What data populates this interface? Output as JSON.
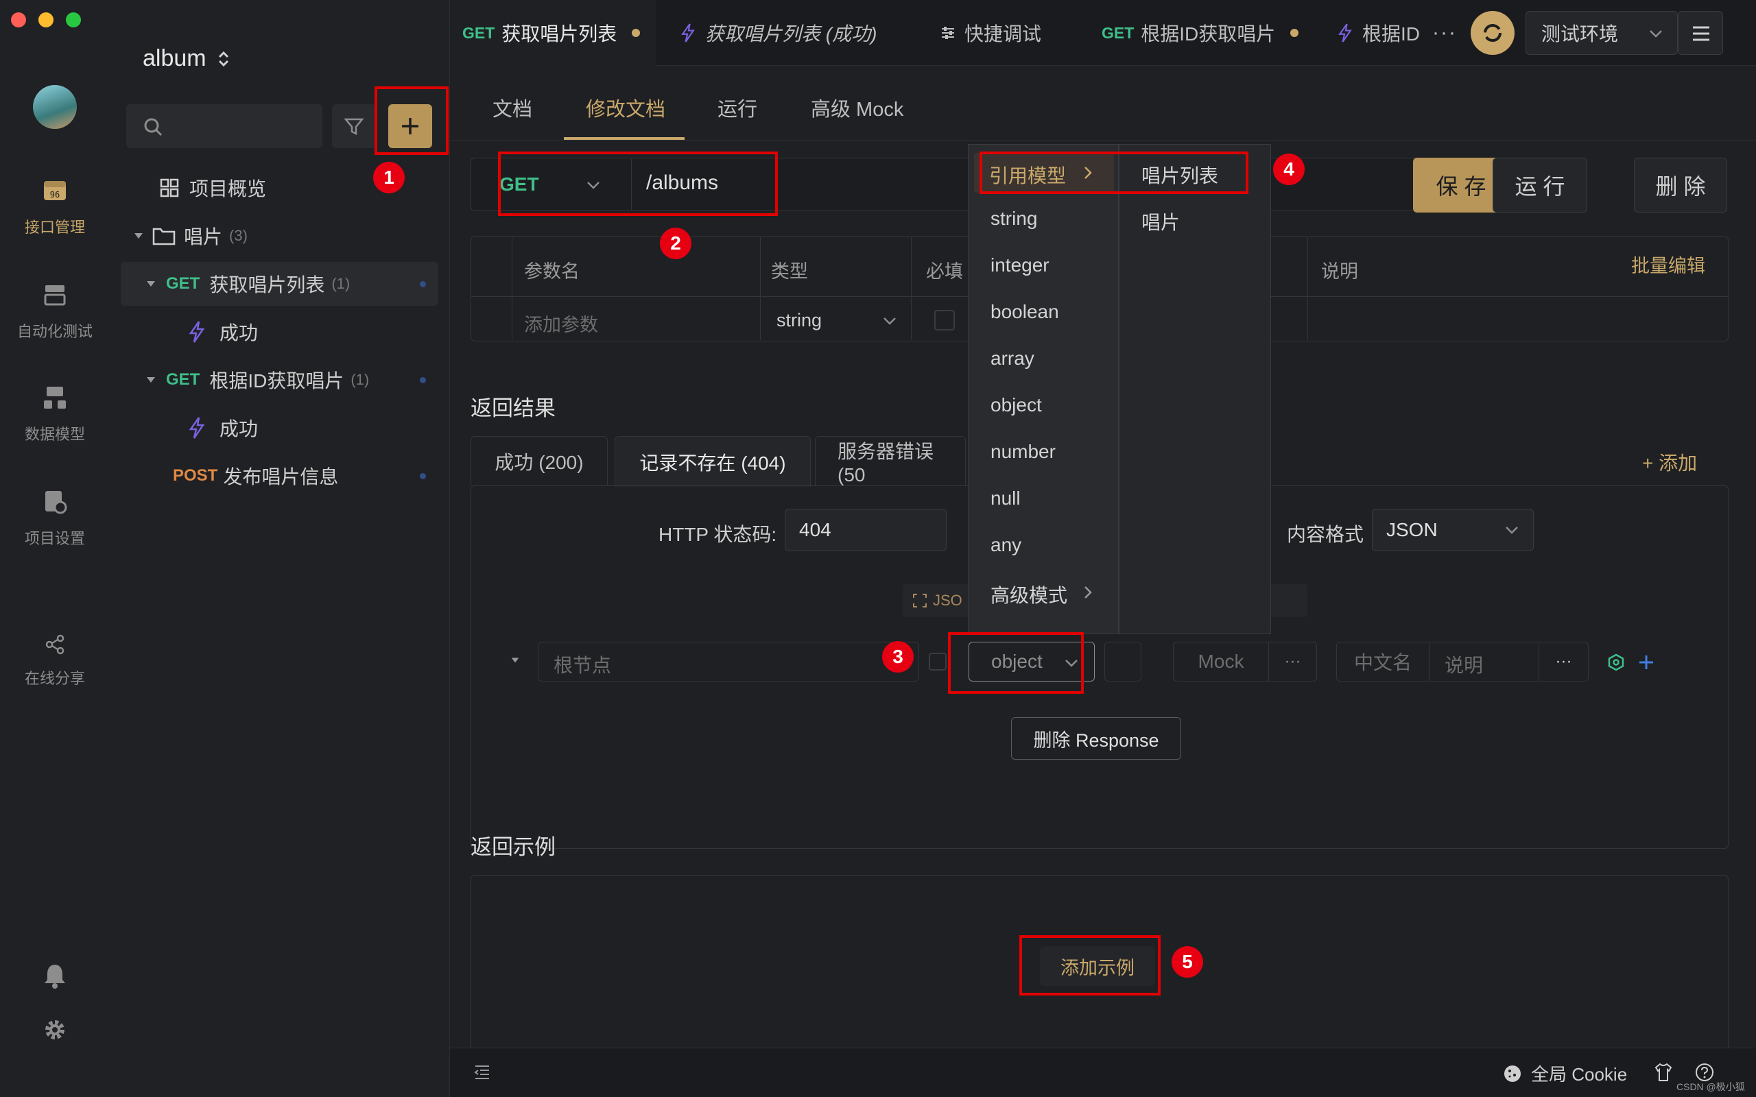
{
  "sidebar_rail": {
    "items": [
      {
        "label": "接口管理",
        "icon": "api-icon",
        "active": true
      },
      {
        "label": "自动化测试",
        "icon": "automation-icon"
      },
      {
        "label": "数据模型",
        "icon": "data-model-icon"
      },
      {
        "label": "项目设置",
        "icon": "project-settings-icon"
      },
      {
        "label": "在线分享",
        "icon": "share-icon"
      }
    ]
  },
  "project": {
    "name": "album"
  },
  "tree": {
    "overview": "项目概览",
    "folder": {
      "name": "唱片",
      "count": "(3)"
    },
    "items": [
      {
        "method": "GET",
        "name": "获取唱片列表",
        "count": "(1)"
      },
      {
        "name": "成功"
      },
      {
        "method": "GET",
        "name": "根据ID获取唱片",
        "count": "(1)"
      },
      {
        "name": "成功"
      },
      {
        "method": "POST",
        "name": "发布唱片信息"
      }
    ]
  },
  "tabs": [
    {
      "method": "GET",
      "label": "获取唱片列表"
    },
    {
      "label": "获取唱片列表 (成功)"
    },
    {
      "label": "快捷调试"
    },
    {
      "method": "GET",
      "label": "根据ID获取唱片"
    },
    {
      "label": "根据ID"
    }
  ],
  "env": {
    "label": "测试环境"
  },
  "subtabs": [
    "文档",
    "修改文档",
    "运行",
    "高级 Mock"
  ],
  "request": {
    "method": "GET",
    "path": "/albums",
    "save": "保 存",
    "run": "运 行",
    "delete": "删 除"
  },
  "params": {
    "headers": [
      "参数名",
      "类型",
      "必填",
      "说明"
    ],
    "bulk_edit": "批量编辑",
    "placeholder": "添加参数",
    "type_value": "string"
  },
  "response": {
    "section_title": "返回结果",
    "tabs": [
      "成功 (200)",
      "记录不存在 (404)",
      "服务器错误 (50"
    ],
    "add": "+ 添加",
    "status_label": "HTTP 状态码:",
    "status_value": "404",
    "content_label": "内容格式",
    "content_value": "JSON",
    "json_hint": "JSO",
    "root_placeholder": "根节点",
    "type_value": "object",
    "mock_placeholder": "Mock",
    "cn_name_placeholder": "中文名",
    "desc_placeholder": "说明",
    "delete_response": "删除 Response"
  },
  "examples": {
    "section_title": "返回示例",
    "add": "添加示例"
  },
  "dropdown": {
    "types": [
      "引用模型",
      "string",
      "integer",
      "boolean",
      "array",
      "object",
      "number",
      "null",
      "any",
      "高级模式"
    ],
    "models": [
      "唱片列表",
      "唱片"
    ]
  },
  "annotations": [
    "1",
    "2",
    "3",
    "4",
    "5"
  ],
  "status_bar": {
    "cookie": "全局 Cookie"
  },
  "watermark": "CSDN @极小狐",
  "colors": {
    "accent": "#c9a86a",
    "get": "#3fbf8a",
    "post": "#e08a45",
    "annotation": "#e60012"
  }
}
